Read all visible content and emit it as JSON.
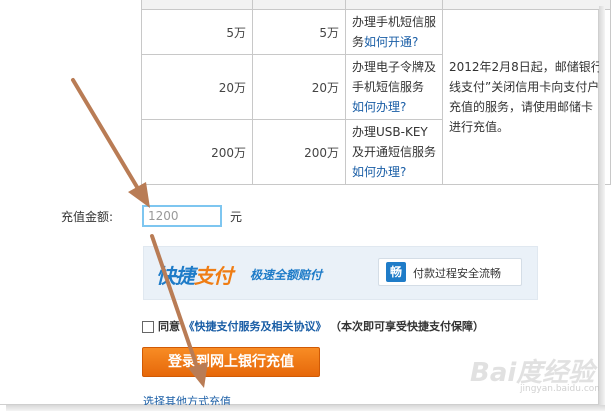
{
  "table": {
    "rows": [
      {
        "a": "5万",
        "b": "5万",
        "svc": "办理手机短信服务",
        "link": "如何开通?"
      },
      {
        "a": "20万",
        "b": "20万",
        "svc": "办理电子令牌及手机短信服务",
        "link": "如何办理?"
      },
      {
        "a": "200万",
        "b": "200万",
        "svc": "办理USB-KEY及开通短信服务",
        "link": "如何办理?"
      }
    ],
    "note": "2012年2月8日起，邮储银行线支付”关闭信用卡向支付户充值的服务，请使用邮储卡进行充值。"
  },
  "form": {
    "amount_label": "充值金额:",
    "amount_value": "1200",
    "unit": "元"
  },
  "banner": {
    "logo_a": "快捷",
    "logo_b": "支付",
    "slogan": "极速全额赔付",
    "safe_icon": "畅",
    "safe_text": "付款过程安全流畅"
  },
  "agree": {
    "agree_label": "同意",
    "agreement_link": "《快捷支付服务及相关协议》",
    "note": "（本次即可享受快捷支付保障）"
  },
  "buttons": {
    "login": "登录到网上银行充值"
  },
  "other_link": "选择其他方式充值",
  "watermark": {
    "text": "Bai度经验",
    "sub": "jingyan.baidu.com"
  },
  "colors": {
    "accent_blue": "#1f7cc8",
    "orange": "#f07a18",
    "arrow": "#b97c55"
  }
}
